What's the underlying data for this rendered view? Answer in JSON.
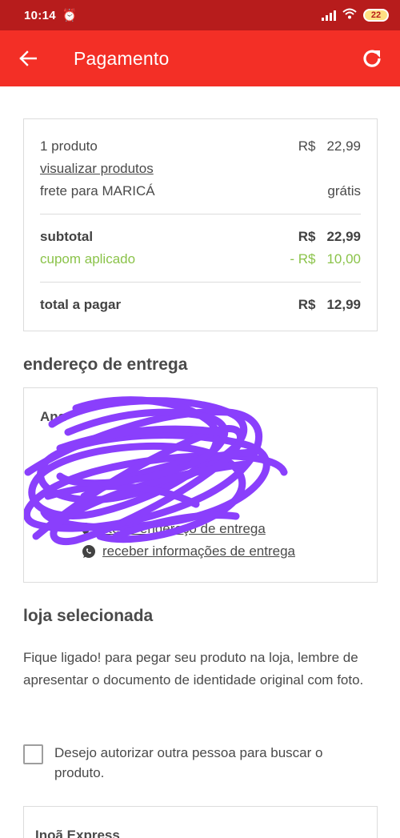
{
  "status_bar": {
    "time": "10:14",
    "battery": "22"
  },
  "app_bar": {
    "title": "Pagamento"
  },
  "summary": {
    "products_label": "1 produto",
    "products_currency": "R$",
    "products_value": "22,99",
    "view_products_link": "visualizar produtos",
    "shipping_label": "frete para MARICÁ",
    "shipping_value": "grátis",
    "subtotal_label": "subtotal",
    "subtotal_currency": "R$",
    "subtotal_value": "22,99",
    "coupon_label": "cupom aplicado",
    "coupon_currency": "- R$",
    "coupon_value": "10,00",
    "total_label": "total a pagar",
    "total_currency": "R$",
    "total_value": "12,99"
  },
  "delivery_address": {
    "section_title": "endereço de entrega",
    "name_partial": "Ana",
    "change_address_link": "alterar endereço de entrega",
    "receive_info_link": "receber informações de entrega"
  },
  "selected_store": {
    "section_title": "loja selecionada",
    "notice": "Fique ligado! para pegar seu produto na loja, lembre de apresentar o documento de identidade original com foto.",
    "authorize_checkbox_label": "Desejo autorizar outra pessoa para buscar o produto.",
    "authorize_checked": false,
    "store_name": "Inoã Express"
  },
  "colors": {
    "status_bar": "#b71c1c",
    "app_bar": "#f32f26",
    "coupon_green": "#8bc34a",
    "scribble": "#8a3ffc"
  }
}
